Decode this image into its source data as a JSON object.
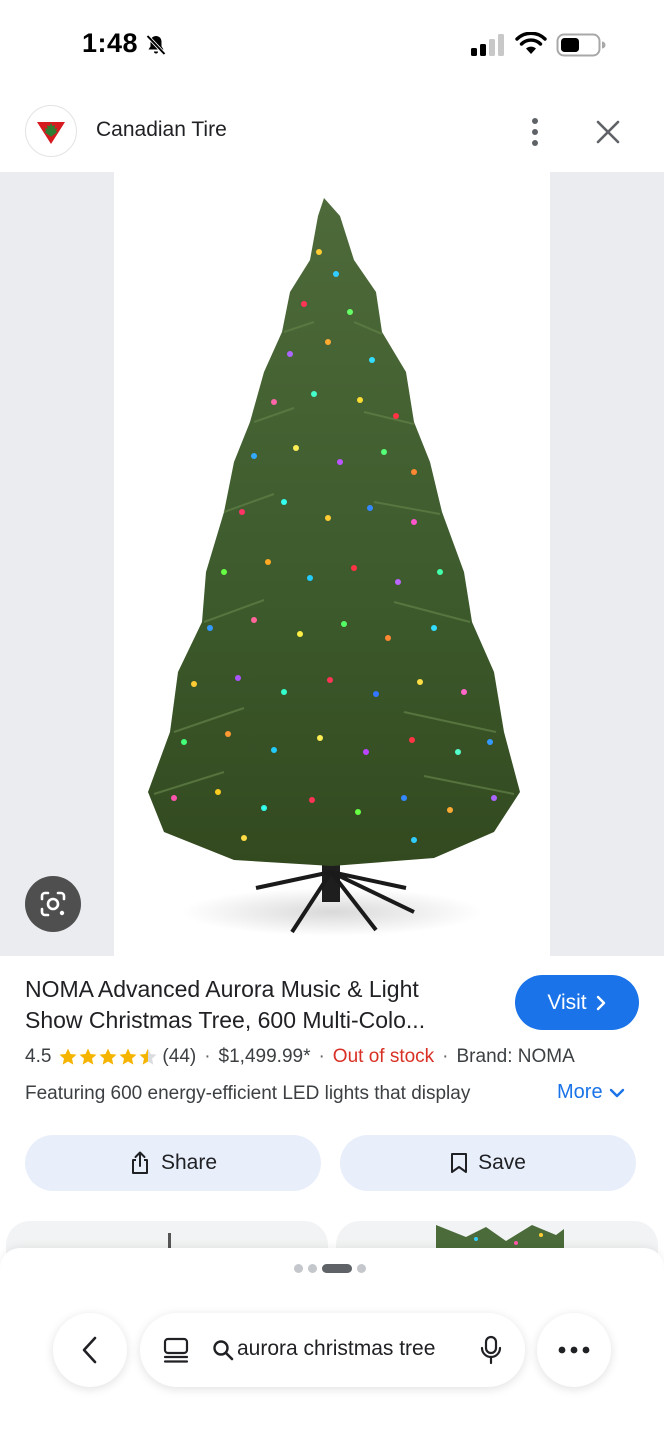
{
  "status_bar": {
    "time": "1:48",
    "icons": [
      "bell-slash-icon",
      "cellular-signal-icon",
      "wifi-icon",
      "battery-icon"
    ]
  },
  "site": {
    "name": "Canadian Tire",
    "logo_icon": "canadian-tire-logo",
    "brand_color": "#d71920"
  },
  "product": {
    "title_line1": "NOMA Advanced Aurora Music & Light",
    "title_line2": "Show Christmas Tree, 600 Multi-Colo...",
    "visit_label": "Visit",
    "rating": "4.5",
    "rating_value": 4.5,
    "rating_max": 5,
    "review_count": "(44)",
    "price": "$1,499.99*",
    "stock_status": "Out of stock",
    "brand": "Brand: NOMA",
    "description": "Featuring 600 energy-efficient LED lights that display",
    "more_label": "More"
  },
  "actions": {
    "share_label": "Share",
    "save_label": "Save"
  },
  "carousel": {
    "page_count": 4,
    "active_page": 3
  },
  "bottom_bar": {
    "search_text": "aurora christmas tree"
  },
  "colors": {
    "accent": "#1a73e8",
    "out_of_stock": "#d93025",
    "star": "#f4b400",
    "action_bg": "#e8effb"
  }
}
